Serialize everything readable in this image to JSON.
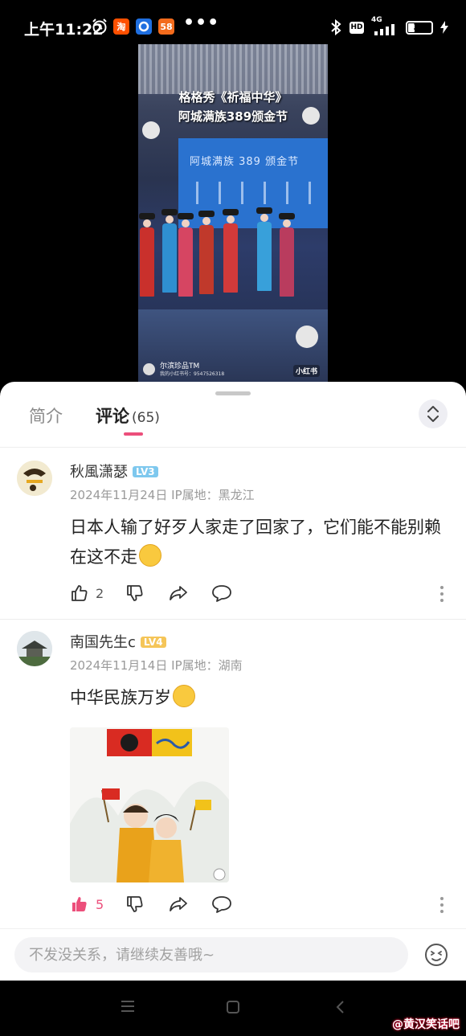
{
  "status_bar": {
    "time": "上午11:22",
    "apps": [
      {
        "name": "taobao-icon",
        "label": "淘",
        "color": "#ff5000"
      },
      {
        "name": "app-blue-icon",
        "label": "",
        "color": "#1f6fe0"
      },
      {
        "name": "app-58-icon",
        "label": "58",
        "color": "#f36b1c"
      }
    ],
    "more_dots": "•••",
    "network": "4G",
    "hd": "HD",
    "battery": "30",
    "battery_level": 0.3
  },
  "video": {
    "title_line1": "格格秀《祈福中华》",
    "title_line2": "阿城满族389颁金节",
    "screen_text": "阿城满族 389 颁金节",
    "uploader": "尔滨珍品TM",
    "uploader_id": "我的小红书号：9547526318",
    "platform_badge": "小红书"
  },
  "tabs": {
    "intro": "简介",
    "comments": "评论",
    "comment_count": "(65)"
  },
  "comments": [
    {
      "author": "秋風潇瑟",
      "level": "LV3",
      "level_color": "#7ec8ee",
      "date": "2024年11月24日",
      "ip": "IP属地：黑龙江",
      "text": "日本人输了好歹人家走了回家了，它们能不能别赖在这不走",
      "likes": "2",
      "liked": false
    },
    {
      "author": "南国先生c",
      "level": "LV4",
      "level_color": "#f5c558",
      "date": "2024年11月14日",
      "ip": "IP属地：湖南",
      "text": "中华民族万岁",
      "likes": "5",
      "liked": true
    }
  ],
  "input": {
    "placeholder": "不发没关系，请继续友善哦~"
  },
  "watermark": "@黄汉笑话吧",
  "colors": {
    "accent": "#ec4f7b",
    "liked": "#ec4f7b"
  }
}
